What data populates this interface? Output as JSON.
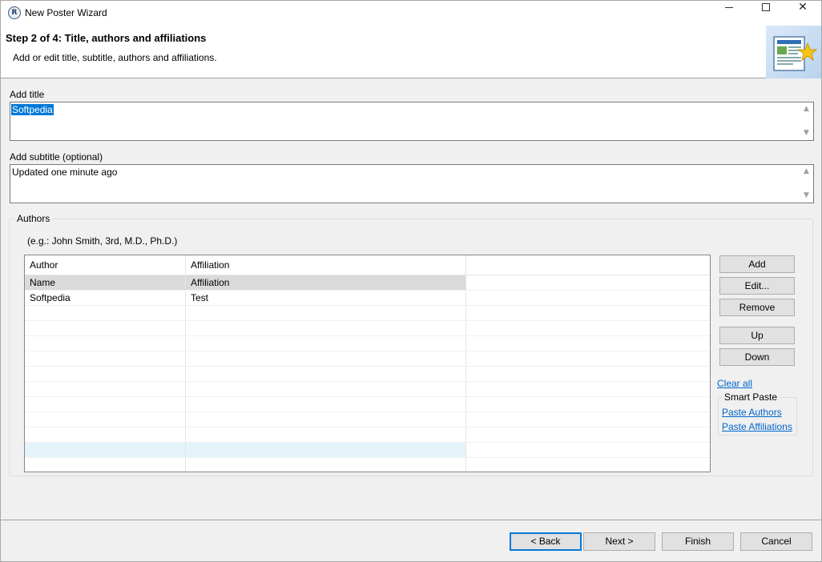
{
  "window": {
    "title": "New Poster Wizard",
    "app_icon_letter": "R"
  },
  "header": {
    "step_title": "Step 2 of 4: Title, authors and affiliations",
    "step_description": "Add or edit title, subtitle, authors and affiliations.",
    "image_icon": "poster-wizard-icon"
  },
  "title_field": {
    "label": "Add title",
    "value": "Softpedia"
  },
  "subtitle_field": {
    "label": "Add subtitle (optional)",
    "value": "Updated one minute ago"
  },
  "authors": {
    "group_label": "Authors",
    "hint": "(e.g.: John Smith, 3rd, M.D., Ph.D.)",
    "columns": [
      "Author",
      "Affiliation"
    ],
    "rows": [
      {
        "author": "Name",
        "affiliation": "Affiliation",
        "selected": true
      },
      {
        "author": "Softpedia",
        "affiliation": "Test",
        "selected": false
      }
    ],
    "buttons": {
      "add": "Add",
      "edit": "Edit...",
      "remove": "Remove",
      "up": "Up",
      "down": "Down"
    },
    "clear_all": "Clear all",
    "smart_paste": {
      "label": "Smart Paste",
      "paste_authors": "Paste Authors",
      "paste_affiliations": "Paste Affiliations"
    }
  },
  "footer": {
    "back": "< Back",
    "next": "Next >",
    "finish": "Finish",
    "cancel": "Cancel"
  }
}
